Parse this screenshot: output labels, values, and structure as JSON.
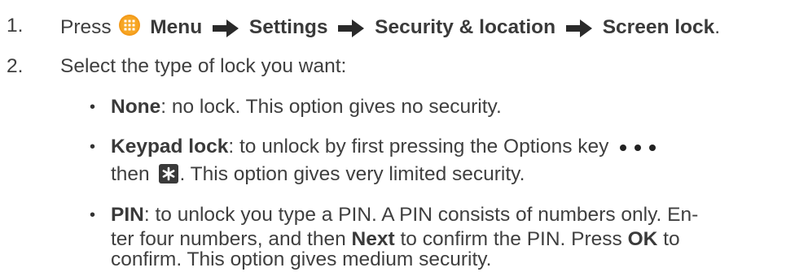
{
  "steps": [
    {
      "number": "1.",
      "text_press": "Press",
      "menu_label": "Menu",
      "settings_label": "Settings",
      "security_label": "Security & location",
      "screen_lock_label": "Screen lock",
      "end_period": "."
    },
    {
      "number": "2.",
      "text": "Select the type of lock you want:"
    }
  ],
  "options": [
    {
      "bullet": "•",
      "name": "None",
      "text": ": no lock. This option gives no security."
    },
    {
      "bullet": "•",
      "name": "Keypad lock",
      "text_line1": ": to unlock by first pressing the Options key",
      "text_line2_a": "then",
      "text_line2_b": ". This option gives very limited security."
    },
    {
      "bullet": "•",
      "name": "PIN",
      "text_line1": ": to unlock you type a PIN. A PIN consists of numbers only. En-",
      "text_line2_a": "ter four numbers, and then",
      "next_label": "Next",
      "text_line2_b": "to confirm the PIN. Press",
      "ok_label": "OK",
      "text_line2_c": "to",
      "text_line3": "confirm. This option gives medium security."
    }
  ],
  "icons": {
    "menu_icon": "menu-grid-icon",
    "arrow_icon": "right-arrow-icon",
    "options_key_icon": "three-dots-icon",
    "star_key_icon": "asterisk-key-icon"
  },
  "colors": {
    "menu_icon_orange": "#f39a1a",
    "star_key_bg": "#3a3a3a",
    "text": "#3f3f3f"
  }
}
